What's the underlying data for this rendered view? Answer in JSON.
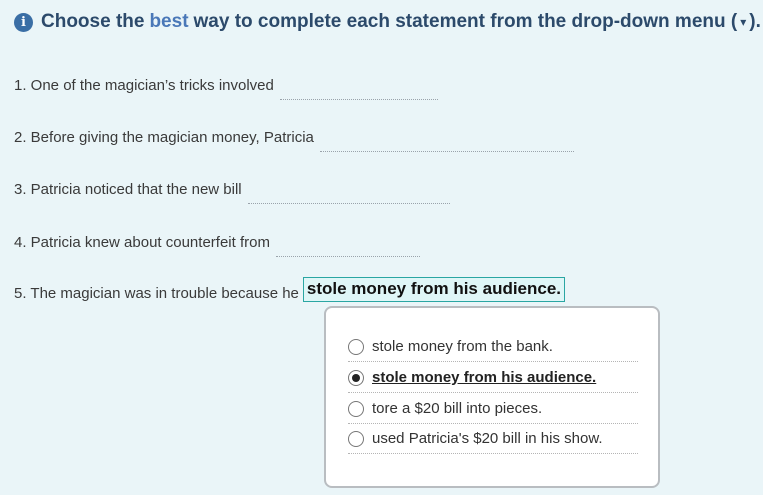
{
  "instruction": {
    "icon": "info-icon",
    "part1": "Choose the",
    "best_word": "best",
    "part2": "way to complete each statement from the drop-down menu (",
    "caret": "▾",
    "part3": ")."
  },
  "questions": [
    {
      "text": "1. One of the magician’s tricks involved"
    },
    {
      "text": "2. Before giving the magician money, Patricia"
    },
    {
      "text": "3. Patricia noticed that the new bill"
    },
    {
      "text": "4. Patricia knew about counterfeit from"
    },
    {
      "text": "5. The magician was in trouble because he",
      "answer": "stole money from his audience."
    }
  ],
  "dropdown": {
    "options": [
      {
        "label": "stole money from the bank.",
        "selected": false
      },
      {
        "label": "stole money from his audience.",
        "selected": true
      },
      {
        "label": "tore a $20 bill into pieces.",
        "selected": false
      },
      {
        "label": "used Patricia's $20 bill in his show.",
        "selected": false
      }
    ]
  },
  "colors": {
    "background": "#eaf5f8",
    "instruction_text": "#2c4a6b",
    "accent_best": "#4a78b8",
    "answer_border": "#2aa6a3",
    "answer_fill": "#dff6f7"
  }
}
